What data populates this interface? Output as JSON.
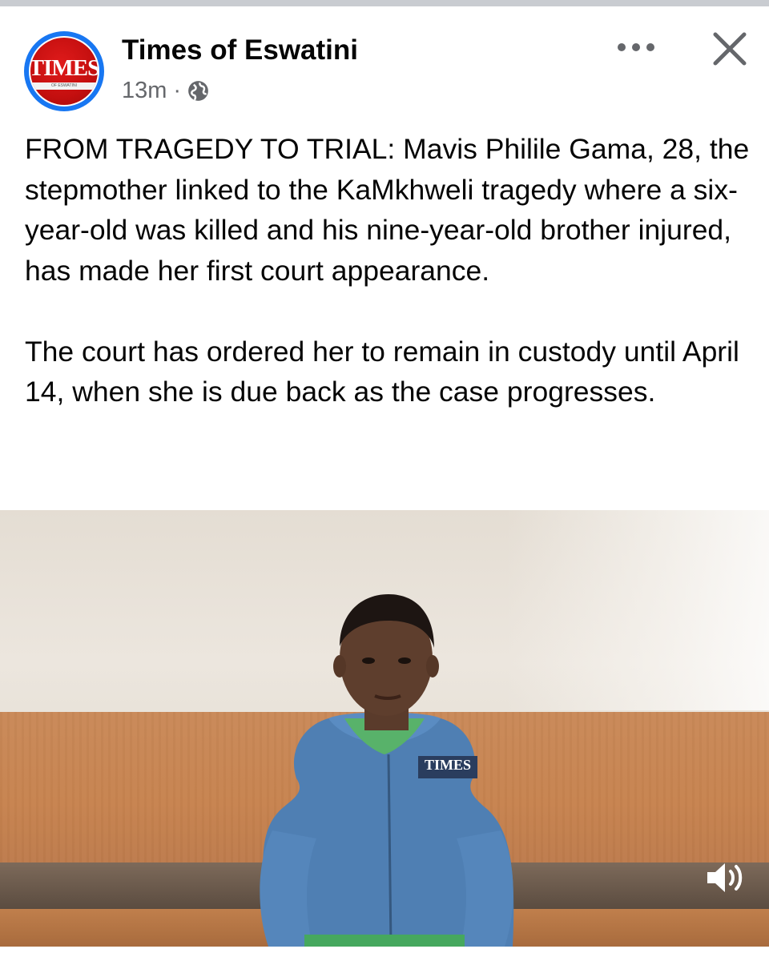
{
  "post": {
    "page_name": "Times of Eswatini",
    "time_ago": "13m",
    "separator": "·",
    "privacy_icon": "globe-icon",
    "avatar_logo": "TIMES",
    "avatar_subtext": "OF ESWATINI",
    "text": "FROM TRAGEDY TO TRIAL: Mavis Philile Gama, 28, the stepmother linked to the KaMkhweli tragedy where a six-year-old was killed and his nine-year-old brother injured, has made her first court appearance.\n\nThe court has ordered her to remain in custody until April 14, when she is due back as the case progresses."
  },
  "header_actions": {
    "more_icon": "more-options-icon",
    "close_icon": "close-icon"
  },
  "video": {
    "watermark": "TIMES",
    "sound_icon": "speaker-icon"
  },
  "colors": {
    "brand_blue": "#1877f2",
    "logo_red": "#d11414",
    "text": "#050505",
    "secondary": "#65676b"
  }
}
